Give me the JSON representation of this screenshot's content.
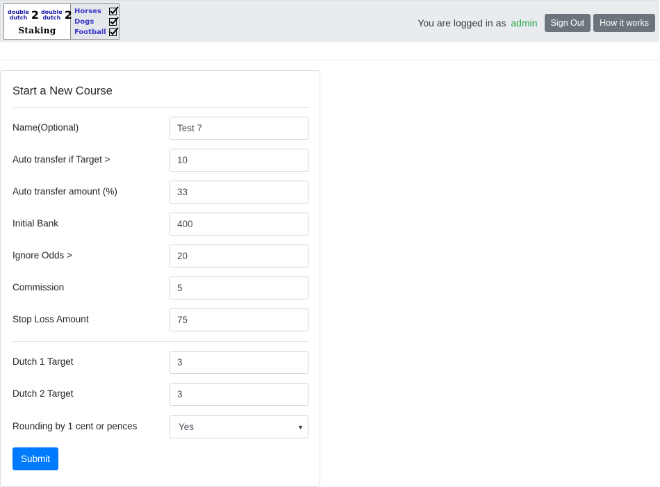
{
  "header": {
    "logo": {
      "dd_left_top": "double",
      "dd_left_bottom": "dutch",
      "dd_right_top": "double",
      "dd_right_bottom": "dutch",
      "number": "2",
      "staking": "Staking",
      "sports": [
        "Horses",
        "Dogs",
        "Football"
      ]
    },
    "logged_in_text": "You are logged in as",
    "username": "admin",
    "sign_out_label": "Sign Out",
    "how_it_works_label": "How it works",
    "username_color": "#28a745",
    "button_color": "#6c757d"
  },
  "form": {
    "title": "Start a New Course",
    "fields": [
      {
        "label": "Name(Optional)",
        "value": "Test 7"
      },
      {
        "label": "Auto transfer if Target >",
        "value": "10"
      },
      {
        "label": "Auto transfer amount (%)",
        "value": "33"
      },
      {
        "label": "Initial Bank",
        "value": "400"
      },
      {
        "label": "Ignore Odds >",
        "value": "20"
      },
      {
        "label": "Commission",
        "value": "5"
      },
      {
        "label": "Stop Loss Amount",
        "value": "75"
      },
      {
        "label": "Dutch 1 Target",
        "value": "3"
      },
      {
        "label": "Dutch 2 Target",
        "value": "3"
      }
    ],
    "rounding": {
      "label": "Rounding by 1 cent or pences",
      "selected": "Yes"
    },
    "submit_label": "Submit",
    "submit_color": "#007bff"
  }
}
